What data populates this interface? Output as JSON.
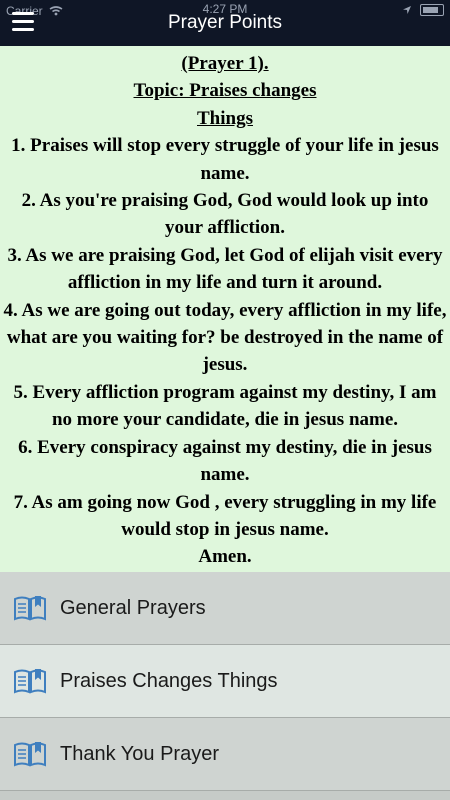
{
  "status": {
    "carrier": "Carrier",
    "time": "4:27 PM"
  },
  "header": {
    "title": "Prayer Points"
  },
  "content": {
    "heading": "(Prayer 1).",
    "topic_line1": "Topic: Praises changes",
    "topic_line2": "Things",
    "points": [
      "1. Praises will stop every struggle of your life in jesus name.",
      "2. As you're  praising God, God would look up into your affliction.",
      "3. As we are praising God, let God of elijah visit every affliction in my life and turn it around.",
      "4. As we are going out today, every affliction  in my life, what are you waiting for? be destroyed in the name of jesus.",
      "5. Every affliction program against my destiny, I am no more your candidate, die in jesus name.",
      "6. Every conspiracy against my destiny, die in jesus name.",
      "7. As am going now God , every struggling in my life would  stop in jesus name."
    ],
    "closing": "Amen."
  },
  "menu": {
    "items": [
      {
        "label": "General Prayers",
        "icon": "book-icon"
      },
      {
        "label": "Praises Changes Things",
        "icon": "book-icon"
      },
      {
        "label": "Thank You Prayer",
        "icon": "book-icon"
      }
    ]
  },
  "colors": {
    "header": "#0f1626",
    "content_bg": "#dff7dc",
    "icon": "#3f7fbf"
  }
}
